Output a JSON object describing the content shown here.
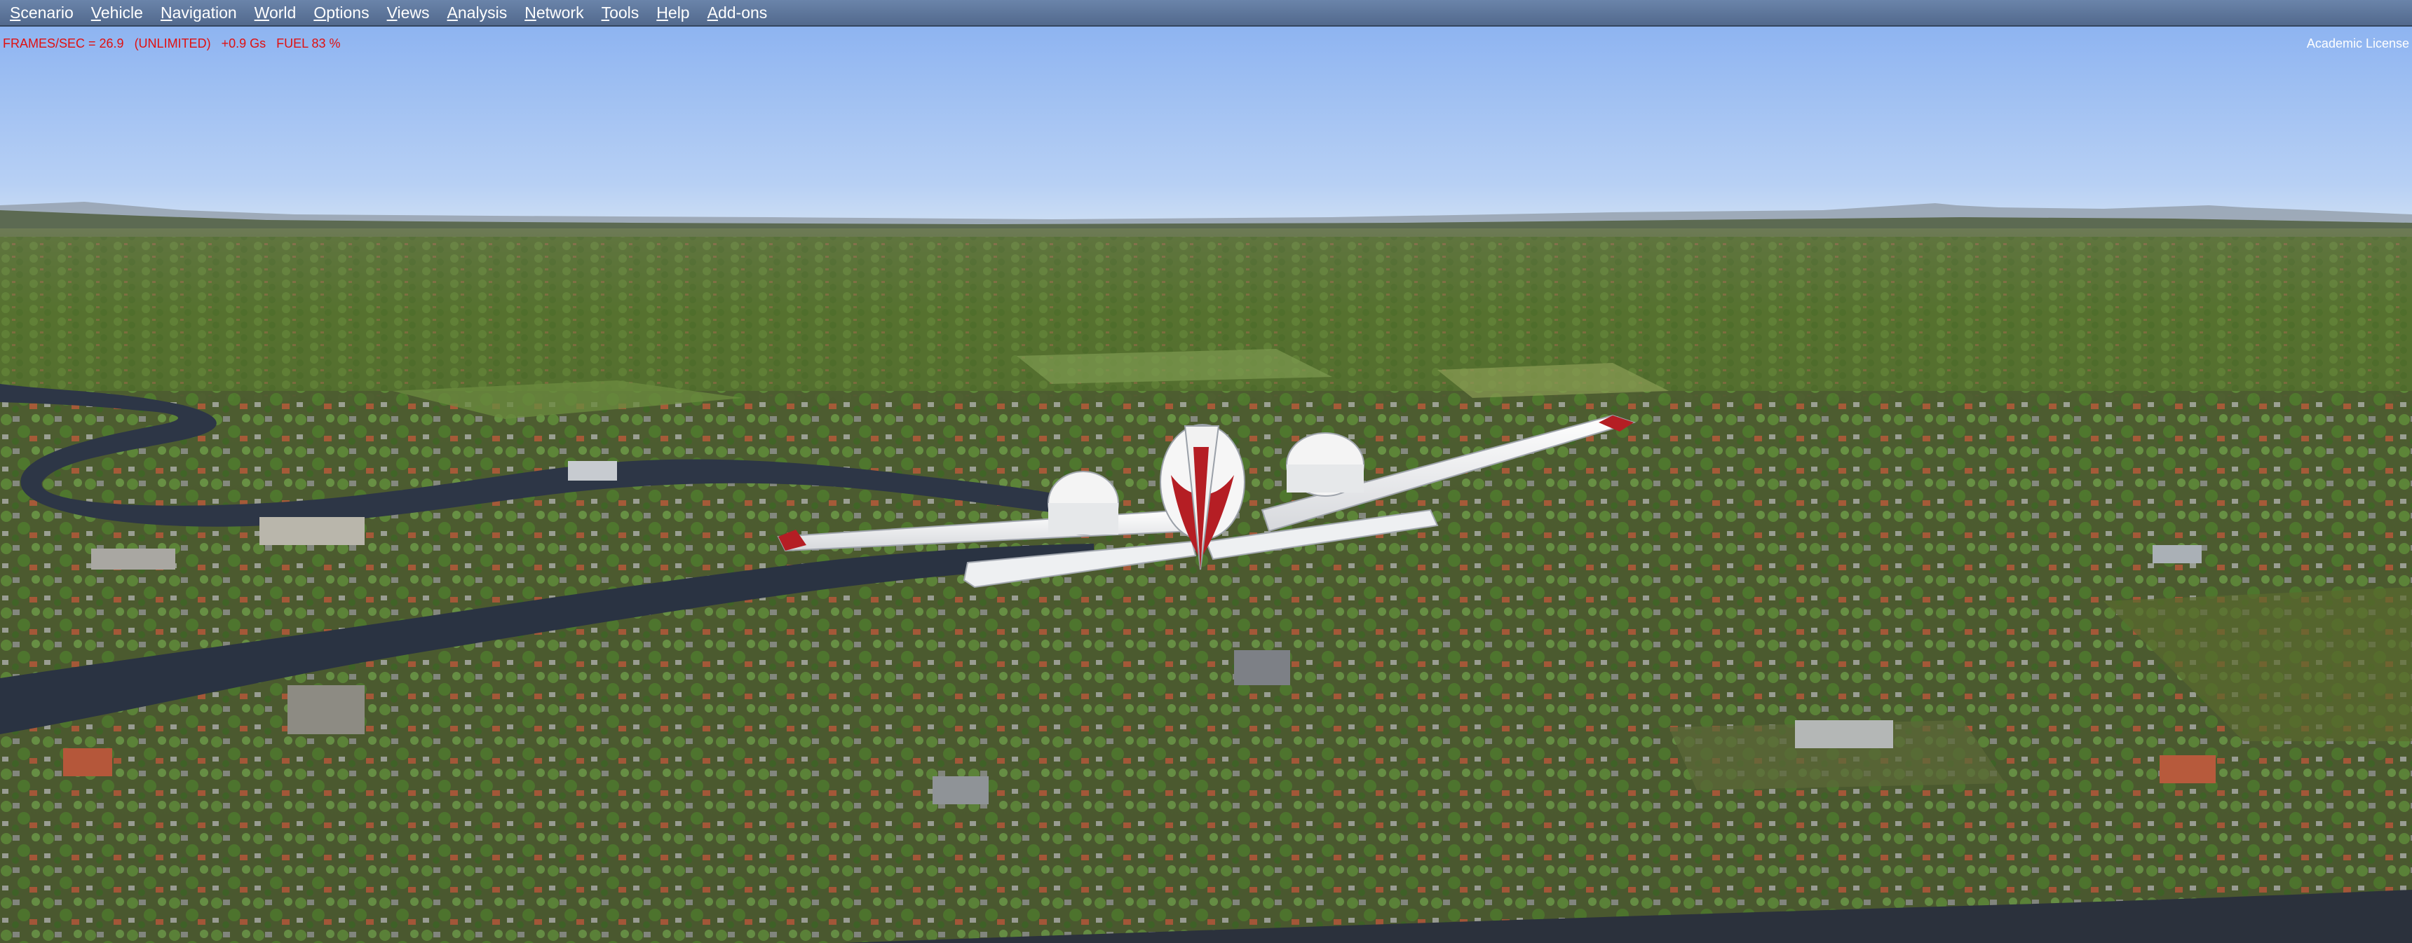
{
  "menu": {
    "items": [
      {
        "label": "Scenario",
        "accel": "S",
        "rest": "cenario"
      },
      {
        "label": "Vehicle",
        "accel": "V",
        "rest": "ehicle"
      },
      {
        "label": "Navigation",
        "accel": "N",
        "rest": "avigation"
      },
      {
        "label": "World",
        "accel": "W",
        "rest": "orld"
      },
      {
        "label": "Options",
        "accel": "O",
        "rest": "ptions"
      },
      {
        "label": "Views",
        "accel": "V",
        "rest": "iews"
      },
      {
        "label": "Analysis",
        "accel": "A",
        "rest": "nalysis"
      },
      {
        "label": "Network",
        "accel": "N",
        "rest": "etwork"
      },
      {
        "label": "Tools",
        "accel": "T",
        "rest": "ools"
      },
      {
        "label": "Help",
        "accel": "H",
        "rest": "elp"
      },
      {
        "label": "Add-ons",
        "accel": "A",
        "rest": "dd-ons"
      }
    ]
  },
  "hud": {
    "status_line": "FRAMES/SEC = 26.9   (UNLIMITED)   +0.9 Gs   FUEL 83 %",
    "color": "#e01010"
  },
  "license": {
    "text": "Academic License"
  },
  "scene": {
    "sky_top": "#93b8f2",
    "sky_horizon": "#c8dbf4",
    "ground": "#4f5e30",
    "river": "#2b3444",
    "aircraft_body": "#f2f2f2",
    "aircraft_stripe": "#b51e24"
  }
}
